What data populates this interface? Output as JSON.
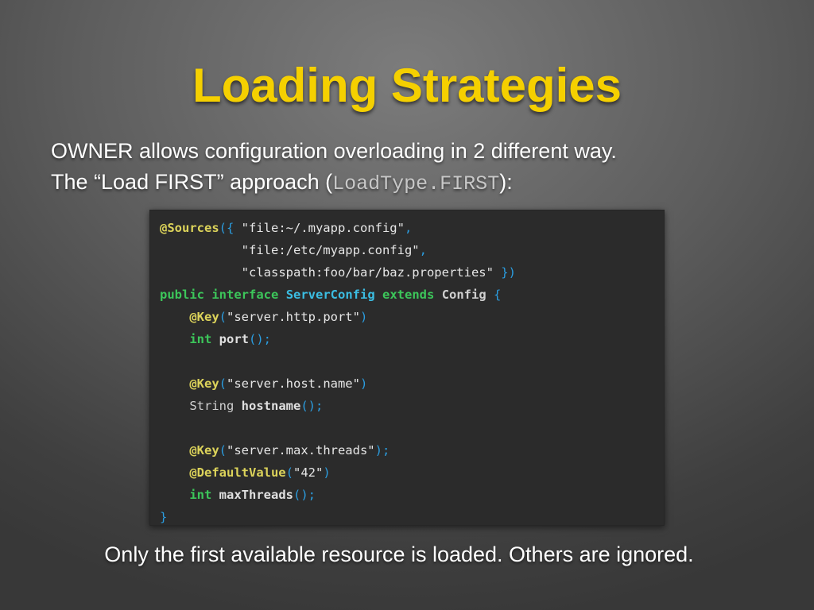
{
  "slide": {
    "title": "Loading Strategies",
    "intro_line1": "OWNER allows configuration overloading in 2 different way.",
    "intro_line2_prefix": "The “Load FIRST” approach (",
    "intro_line2_code": "LoadType.FIRST",
    "intro_line2_suffix": "):",
    "footer": "Only the first available resource is loaded. Others are ignored."
  },
  "colors": {
    "title": "#f5d000",
    "code_background": "#2b2b2b",
    "annotation": "#dcd35a",
    "keyword": "#3cc65a",
    "type": "#3bbde2",
    "punctuation": "#2b9de0"
  },
  "code": {
    "lines": [
      [
        {
          "t": "@Sources",
          "k": "annotation"
        },
        {
          "t": "({ ",
          "k": "punct"
        },
        {
          "t": "\"file:~/.myapp.config\"",
          "k": "string"
        },
        {
          "t": ",",
          "k": "punct"
        }
      ],
      [
        {
          "t": "           ",
          "k": "plain"
        },
        {
          "t": "\"file:/etc/myapp.config\"",
          "k": "string"
        },
        {
          "t": ",",
          "k": "punct"
        }
      ],
      [
        {
          "t": "           ",
          "k": "plain"
        },
        {
          "t": "\"classpath:foo/bar/baz.properties\"",
          "k": "string"
        },
        {
          "t": " })",
          "k": "punct"
        }
      ],
      [
        {
          "t": "public",
          "k": "keyword"
        },
        {
          "t": " ",
          "k": "plain"
        },
        {
          "t": "interface",
          "k": "keyword"
        },
        {
          "t": " ",
          "k": "plain"
        },
        {
          "t": "ServerConfig",
          "k": "type"
        },
        {
          "t": " ",
          "k": "plain"
        },
        {
          "t": "extends",
          "k": "keyword"
        },
        {
          "t": " ",
          "k": "plain"
        },
        {
          "t": "Config",
          "k": "plain"
        },
        {
          "t": " {",
          "k": "punct"
        }
      ],
      [
        {
          "t": "    ",
          "k": "plain"
        },
        {
          "t": "@Key",
          "k": "annotation"
        },
        {
          "t": "(",
          "k": "punct"
        },
        {
          "t": "\"server.http.port\"",
          "k": "string"
        },
        {
          "t": ")",
          "k": "punct"
        }
      ],
      [
        {
          "t": "    ",
          "k": "plain"
        },
        {
          "t": "int",
          "k": "keyword"
        },
        {
          "t": " ",
          "k": "plain"
        },
        {
          "t": "port",
          "k": "method"
        },
        {
          "t": "();",
          "k": "punct"
        }
      ],
      [],
      [
        {
          "t": "    ",
          "k": "plain"
        },
        {
          "t": "@Key",
          "k": "annotation"
        },
        {
          "t": "(",
          "k": "punct"
        },
        {
          "t": "\"server.host.name\"",
          "k": "string"
        },
        {
          "t": ")",
          "k": "punct"
        }
      ],
      [
        {
          "t": "    ",
          "k": "plain"
        },
        {
          "t": "String",
          "k": "ident"
        },
        {
          "t": " ",
          "k": "plain"
        },
        {
          "t": "hostname",
          "k": "method"
        },
        {
          "t": "();",
          "k": "punct"
        }
      ],
      [],
      [
        {
          "t": "    ",
          "k": "plain"
        },
        {
          "t": "@Key",
          "k": "annotation"
        },
        {
          "t": "(",
          "k": "punct"
        },
        {
          "t": "\"server.max.threads\"",
          "k": "string"
        },
        {
          "t": ");",
          "k": "punct"
        }
      ],
      [
        {
          "t": "    ",
          "k": "plain"
        },
        {
          "t": "@DefaultValue",
          "k": "annotation"
        },
        {
          "t": "(",
          "k": "punct"
        },
        {
          "t": "\"42\"",
          "k": "string"
        },
        {
          "t": ")",
          "k": "punct"
        }
      ],
      [
        {
          "t": "    ",
          "k": "plain"
        },
        {
          "t": "int",
          "k": "keyword"
        },
        {
          "t": " ",
          "k": "plain"
        },
        {
          "t": "maxThreads",
          "k": "method"
        },
        {
          "t": "();",
          "k": "punct"
        }
      ],
      [
        {
          "t": "}",
          "k": "punct"
        }
      ]
    ]
  }
}
